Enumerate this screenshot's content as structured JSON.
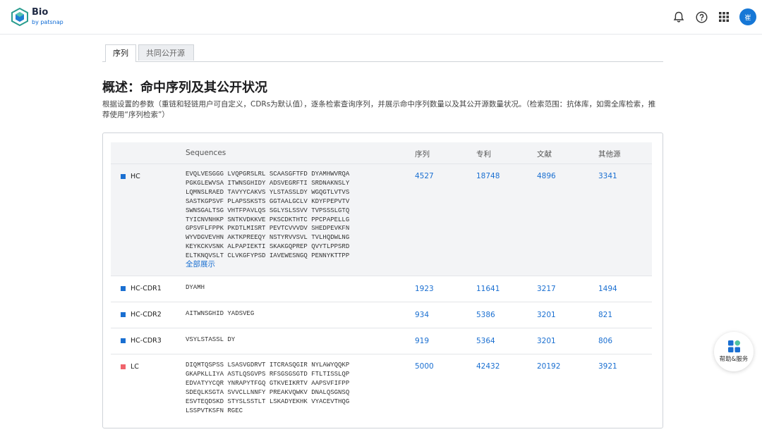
{
  "header": {
    "brand": "Bio",
    "brand_sub": "by patsnap",
    "avatar_text": "崔",
    "icons": [
      "bell-icon",
      "help-icon",
      "apps-grid-icon"
    ]
  },
  "tabs": [
    {
      "label": "序列",
      "active": true
    },
    {
      "label": "共同公开源",
      "active": false
    }
  ],
  "title": "概述：命中序列及其公开状况",
  "description": "根据设置的参数（重链和轻链用户可自定义，CDRs为默认值），逐条检索查询序列，并展示命中序列数量以及其公开源数量状况。（检索范围：抗体库，如需全库检索，推荐使用“序列检索”）",
  "table": {
    "headers": [
      "Sequences",
      "序列",
      "专利",
      "文献",
      "其他源"
    ],
    "expand_label": "全部展示",
    "rows": [
      {
        "label": "HC",
        "color": "#1a6fd1",
        "sequence": "EVQLVESGGG LVQPGRSLRL SCAASGFTFD DYAMHWVRQA\nPGKGLEWVSA ITWNSGHIDY ADSVEGRFTI SRDNAKNSLY\nLQMNSLRAED TAVYYCAKVS YLSTASSLDY WGQGTLVTVS\nSASTKGPSVF PLAPSSKSTS GGTAALGCLV KDYFPEPVTV\nSWNSGALTSG VHTFPAVLQS SGLYSLSSVV TVPSSSLGTQ\nTYICNVNHKP SNTKVDKKVE PKSCDKTHTC PPCPAPELLG\nGPSVFLFPPK PKDTLMISRT PEVTCVVVDV SHEDPEVKFN\nWYVDGVEVHN AKTKPREEQY NSTYRVVSVL TVLHQDWLNG\nKEYKCKVSNK ALPAPIEKTI SKAKGQPREP QVYTLPPSRD\nELTKNQVSLT CLVKGFYPSD IAVEWESNGQ PENNYKTTPP",
        "seq_count": "4527",
        "patents": "18748",
        "literature": "4896",
        "other": "3341"
      },
      {
        "label": "HC-CDR1",
        "color": "#1a6fd1",
        "sequence": "DYAMH",
        "seq_count": "1923",
        "patents": "11641",
        "literature": "3217",
        "other": "1494"
      },
      {
        "label": "HC-CDR2",
        "color": "#1a6fd1",
        "sequence": "AITWNSGHID YADSVEG",
        "seq_count": "934",
        "patents": "5386",
        "literature": "3201",
        "other": "821"
      },
      {
        "label": "HC-CDR3",
        "color": "#1a6fd1",
        "sequence": "VSYLSTASSL DY",
        "seq_count": "919",
        "patents": "5364",
        "literature": "3201",
        "other": "806"
      },
      {
        "label": "LC",
        "color": "#f0646c",
        "sequence": "DIQMTQSPSS LSASVGDRVT ITCRASQGIR NYLAWYQQKP\nGKAPKLLIYA ASTLQSGVPS RFSGSGSGTD FTLTISSLQP\nEDVATYYCQR YNRAPYTFGQ GTKVEIKRTV AAPSVFIFPP\nSDEQLKSGTA SVVCLLNNFY PREAKVQWKV DNALQSGNSQ\nESVTEQDSKD STYSLSSTLT LSKADYEKHK VYACEVTHQG\nLSSPVTKSFN RGEC",
        "seq_count": "5000",
        "patents": "42432",
        "literature": "20192",
        "other": "3921"
      }
    ]
  },
  "help_widget": {
    "label": "帮助&服务"
  }
}
